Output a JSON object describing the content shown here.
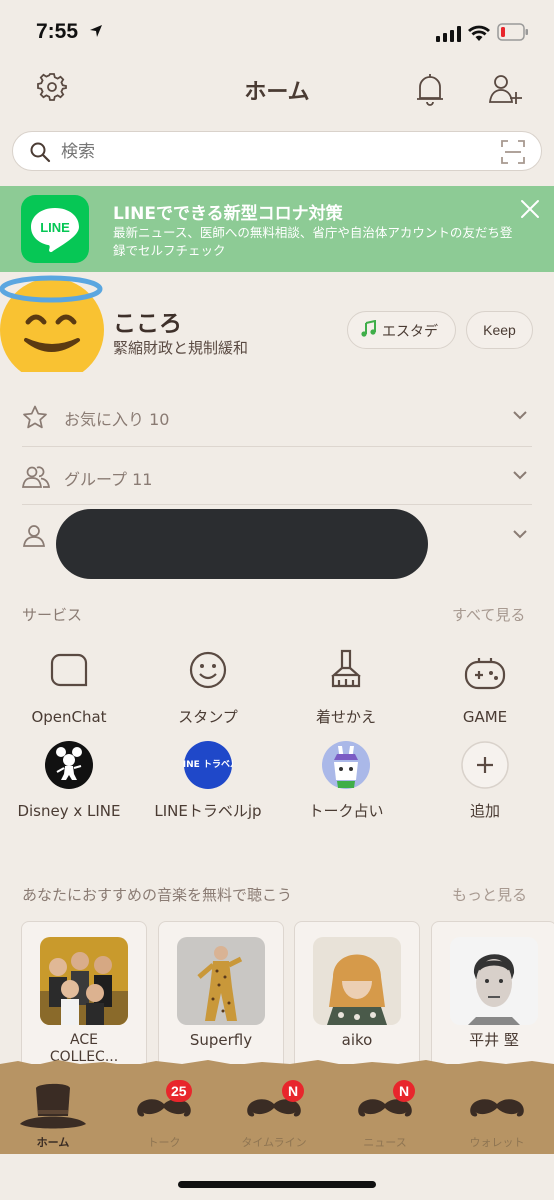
{
  "status_bar": {
    "time": "7:55"
  },
  "header": {
    "title": "ホーム"
  },
  "search": {
    "placeholder": "検索"
  },
  "banner": {
    "logo_text": "LINE",
    "title": "LINEでできる新型コロナ対策",
    "subtitle": "最新ニュース、医師への無料相談、省庁や自治体アカウントの友だち登録でセルフチェック"
  },
  "profile": {
    "name": "こころ",
    "status": "緊縮財政と規制緩和",
    "music_label": "エスタデ",
    "keep_label": "Keep"
  },
  "lists": {
    "favorites": "お気に入り 10",
    "groups": "グループ 11"
  },
  "services": {
    "title": "サービス",
    "see_all": "すべて見る",
    "items": [
      {
        "label": "OpenChat",
        "icon": "openchat-icon"
      },
      {
        "label": "スタンプ",
        "icon": "sticker-icon"
      },
      {
        "label": "着せかえ",
        "icon": "theme-brush-icon"
      },
      {
        "label": "GAME",
        "icon": "game-controller-icon"
      },
      {
        "label": "Disney x LINE",
        "icon": "disney-mickey-icon"
      },
      {
        "label": "LINEトラベルjp",
        "icon": "line-travel-icon",
        "icon_text": "LINE トラベル"
      },
      {
        "label": "トーク占い",
        "icon": "fortune-rabbit-icon"
      },
      {
        "label": "追加",
        "icon": "plus-icon"
      }
    ]
  },
  "music": {
    "title": "あなたにおすすめの音楽を無料で聴こう",
    "see_more": "もっと見る",
    "artists": [
      "ACE COLLEC...",
      "Superfly",
      "aiko",
      "平井 堅"
    ]
  },
  "tabs": [
    {
      "label": "ホーム",
      "active": true
    },
    {
      "label": "トーク",
      "badge": "25"
    },
    {
      "label": "タイムライン",
      "badge": "N"
    },
    {
      "label": "ニュース",
      "badge": "N"
    },
    {
      "label": "ウォレット"
    }
  ],
  "colors": {
    "background": "#f1ece6",
    "banner": "#8dcb95",
    "line_green": "#06c755",
    "tab_bar": "#b79464",
    "badge_red": "#e8262c"
  }
}
